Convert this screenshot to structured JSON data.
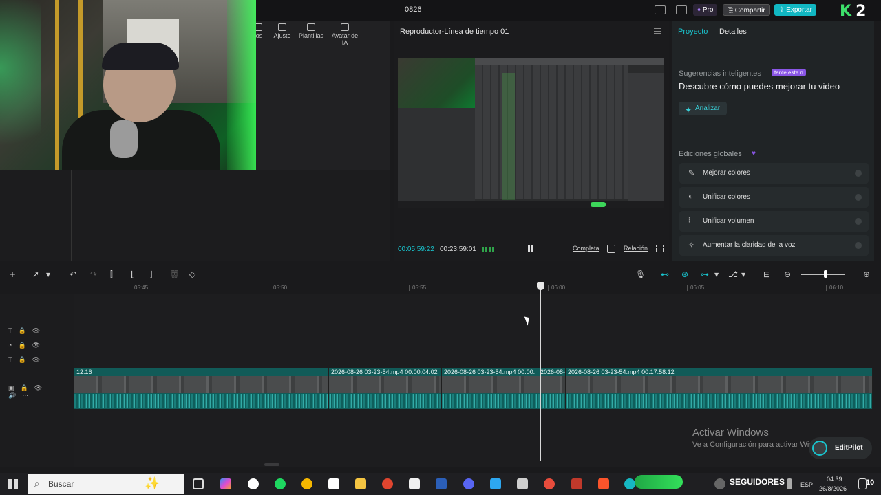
{
  "window": {
    "title": "0826"
  },
  "topbar": {
    "pro_label": "Pro",
    "share_label": "Compartir",
    "export_label": "Exportar",
    "overlay_logo": "K",
    "overlay_number": "2"
  },
  "media_tabs": [
    {
      "label": "ros"
    },
    {
      "label": "Ajuste"
    },
    {
      "label": "Plantillas"
    },
    {
      "label": "Avatar de IA"
    }
  ],
  "player": {
    "title": "Reproductor-Línea de tiempo 01",
    "current_time": "00:05:59:22",
    "total_time": "00:23:59:01",
    "full_label": "Completa",
    "ratio_label": "Relación"
  },
  "right_panel": {
    "tabs": [
      {
        "label": "Proyecto"
      },
      {
        "label": "Detalles"
      }
    ],
    "suggestions_label": "Sugerencias inteligentes",
    "suggestions_badge": "tante este n",
    "headline": "Descubre cómo puedes mejorar tu video",
    "analyze_label": "Analizar",
    "global_edits_label": "Ediciones globales",
    "global_edits": [
      {
        "label": "Mejorar colores",
        "icon": "magic-wand-icon"
      },
      {
        "label": "Unificar colores",
        "icon": "color-icon"
      },
      {
        "label": "Unificar volumen",
        "icon": "equalizer-icon"
      },
      {
        "label": "Aumentar la claridad de la voz",
        "icon": "voice-icon"
      }
    ]
  },
  "ruler": {
    "labels": [
      "05:45",
      "05:50",
      "05:55",
      "06:00",
      "06:05",
      "06:10"
    ]
  },
  "timeline": {
    "clips": [
      {
        "label": "12:16"
      },
      {
        "label": "2026-08-26 03-23-54.mp4    00:00:04:02"
      },
      {
        "label": "2026-08-26 03-23-54.mp4    00:00:"
      },
      {
        "label": "2026-08-"
      },
      {
        "label": "2026-08-26 03-23-54.mp4    00:17:58:12"
      }
    ]
  },
  "watermark": {
    "title": "Activar Windows",
    "subtitle": "Ve a Configuración para activar Windows."
  },
  "editpilot_label": "EditPilot",
  "taskbar": {
    "search_placeholder": "Buscar",
    "overlay_text": "SEGUIDORES",
    "lang": "ESP",
    "time": "04:39",
    "date": "26/8/2026",
    "notifications": "10"
  }
}
